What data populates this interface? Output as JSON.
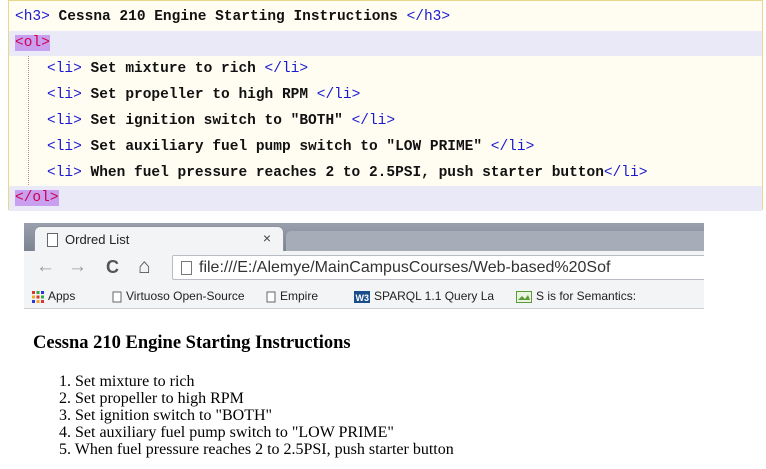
{
  "code": {
    "lines": [
      {
        "open": "<h3>",
        "text": " Cessna 210 Engine Starting Instructions ",
        "close": "</h3>"
      },
      {
        "open": "<ol>",
        "text": "",
        "close": ""
      },
      {
        "open": "<li>",
        "text": " Set mixture to rich ",
        "close": "</li>"
      },
      {
        "open": "<li>",
        "text": " Set propeller to high RPM ",
        "close": "</li>"
      },
      {
        "open": "<li>",
        "text": " Set ignition switch to \"BOTH\" ",
        "close": "</li>"
      },
      {
        "open": "<li>",
        "text": " Set auxiliary fuel pump switch to \"LOW PRIME\" ",
        "close": "</li>"
      },
      {
        "open": "<li>",
        "text": " When fuel pressure reaches 2 to 2.5PSI, push starter button",
        "close": "</li>"
      },
      {
        "open": "</ol>",
        "text": "",
        "close": ""
      }
    ]
  },
  "browser": {
    "tab_title": "Ordred List",
    "tab_close": "×",
    "url": "file:///E:/Alemye/MainCampusCourses/Web-based%20Sof",
    "nav": {
      "back": "←",
      "forward": "→",
      "reload": "C",
      "home": "⌂"
    },
    "bookmarks": [
      {
        "label": "Apps",
        "icon": "apps-grid-icon"
      },
      {
        "label": "Virtuoso Open-Source",
        "icon": "page-icon"
      },
      {
        "label": "Empire",
        "icon": "page-icon"
      },
      {
        "label": "SPARQL 1.1 Query La",
        "icon": "w3c-icon"
      },
      {
        "label": "S is for Semantics:",
        "icon": "image-icon"
      }
    ]
  },
  "page": {
    "heading": "Cessna 210 Engine Starting Instructions",
    "items": [
      "1. Set mixture to rich",
      "2. Set propeller to high RPM",
      "3. Set ignition switch to \"BOTH\"",
      "4. Set auxiliary fuel pump switch to \"LOW PRIME\"",
      "5. When fuel pressure reaches 2 to 2.5PSI, push starter button"
    ]
  },
  "colors": {
    "tag": "#1a1ad0",
    "selected_tag_bg": "#c9a0f0",
    "editor_bg": "#fffdf2"
  }
}
